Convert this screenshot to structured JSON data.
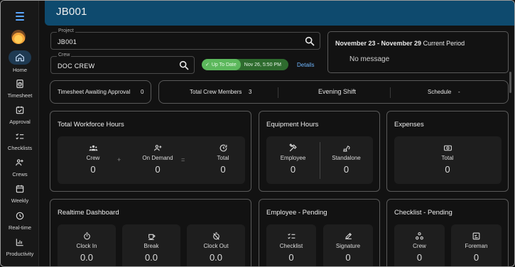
{
  "header": {
    "title": "JB001"
  },
  "sidebar": {
    "items": [
      {
        "label": "Home",
        "icon": "home-icon"
      },
      {
        "label": "Timesheet",
        "icon": "timesheet-icon"
      },
      {
        "label": "Approval",
        "icon": "approval-icon"
      },
      {
        "label": "Checklists",
        "icon": "checklist-icon"
      },
      {
        "label": "Crews",
        "icon": "crews-icon"
      },
      {
        "label": "Weekly",
        "icon": "calendar-icon"
      },
      {
        "label": "Real-time",
        "icon": "realtime-icon"
      },
      {
        "label": "Productivity",
        "icon": "productivity-icon"
      }
    ]
  },
  "project": {
    "label": "Project",
    "value": "JB001"
  },
  "crew": {
    "label": "Crew",
    "value": "DOC CREW"
  },
  "status": {
    "state": "Up To Date",
    "timestamp": "Nov 26, 5:50 PM",
    "details": "Details"
  },
  "period": {
    "range": "November 23 - November 29",
    "suffix": "Current Period",
    "message": "No message"
  },
  "infobar": {
    "awaiting_label": "Timesheet Awaiting Approval",
    "awaiting_value": "0",
    "members_label": "Total Crew Members",
    "members_value": "3",
    "shift": "Evening Shift",
    "schedule_label": "Schedule",
    "schedule_value": "-"
  },
  "workforce": {
    "title": "Total Workforce Hours",
    "crew_label": "Crew",
    "crew_value": "0",
    "ondemand_label": "On Demand",
    "ondemand_value": "0",
    "total_label": "Total",
    "total_value": "0",
    "plus": "+",
    "equals": "="
  },
  "equipment": {
    "title": "Equipment Hours",
    "employee_label": "Employee",
    "employee_value": "0",
    "standalone_label": "Standalone",
    "standalone_value": "0"
  },
  "expenses": {
    "title": "Expenses",
    "total_label": "Total",
    "total_value": "0"
  },
  "realtime": {
    "title": "Realtime Dashboard",
    "clockin_label": "Clock In",
    "clockin_value": "0.0",
    "break_label": "Break",
    "break_value": "0.0",
    "clockout_label": "Clock Out",
    "clockout_value": "0.0"
  },
  "employee_pending": {
    "title": "Employee - Pending",
    "checklist_label": "Checklist",
    "checklist_value": "0",
    "signature_label": "Signature",
    "signature_value": "0"
  },
  "checklist_pending": {
    "title": "Checklist - Pending",
    "crew_label": "Crew",
    "crew_value": "0",
    "foreman_label": "Foreman",
    "foreman_value": "0"
  },
  "colors": {
    "header": "#0e4a6e",
    "accent": "#5aa7ff",
    "status_green": "#5cb85c"
  }
}
